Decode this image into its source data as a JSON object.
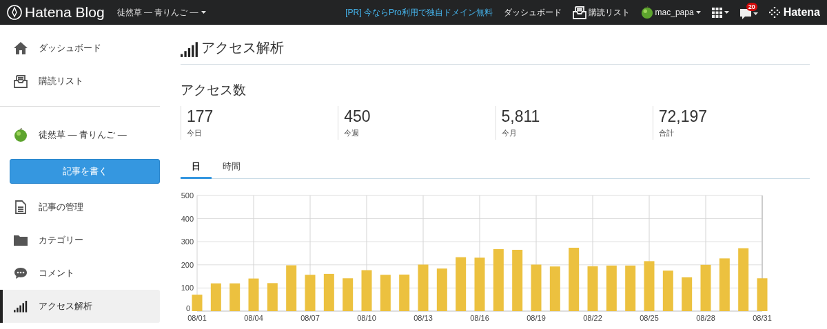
{
  "topbar": {
    "logo": "Hatena Blog",
    "blog_menu": "徒然草 — 青りんご —",
    "promo": "[PR] 今ならPro利用で独自ドメイン無料",
    "links": [
      {
        "kind": "text",
        "label": "ダッシュボード"
      },
      {
        "kind": "reader",
        "label": "購読リスト"
      }
    ],
    "user": "mac_papa",
    "notification_count": "20",
    "brand": "Hatena"
  },
  "sidebar": {
    "items": [
      {
        "kind": "home",
        "label": "ダッシュボード",
        "selected": false
      },
      {
        "kind": "reader",
        "label": "購読リスト",
        "selected": false
      },
      {
        "kind": "divider"
      },
      {
        "kind": "blog",
        "label": "徒然草 — 青りんご —",
        "selected": false
      },
      {
        "kind": "write",
        "label": "記事を書く"
      },
      {
        "kind": "doc",
        "label": "記事の管理",
        "selected": false
      },
      {
        "kind": "folder",
        "label": "カテゴリー",
        "selected": false
      },
      {
        "kind": "comment",
        "label": "コメント",
        "selected": false
      },
      {
        "kind": "signal",
        "label": "アクセス解析",
        "selected": true
      }
    ]
  },
  "main": {
    "title": "アクセス解析",
    "section_title": "アクセス数",
    "stats": [
      {
        "value": "177",
        "label": "今日"
      },
      {
        "value": "450",
        "label": "今週"
      },
      {
        "value": "5,811",
        "label": "今月"
      },
      {
        "value": "72,197",
        "label": "合計"
      }
    ],
    "tabs": [
      {
        "label": "日",
        "selected": true
      },
      {
        "label": "時間",
        "selected": false
      }
    ],
    "chart_data": {
      "type": "bar",
      "grid": true,
      "categories": [
        "08/01",
        null,
        null,
        "08/04",
        null,
        null,
        "08/07",
        null,
        null,
        "08/10",
        null,
        null,
        "08/13",
        null,
        null,
        "08/16",
        null,
        null,
        "08/19",
        null,
        null,
        "08/22",
        null,
        null,
        "08/25",
        null,
        null,
        "08/28",
        null,
        null,
        "08/31"
      ],
      "series": [
        {
          "color": "#ecc13f",
          "values": [
            71,
            120,
            120,
            141,
            121,
            198,
            157,
            161,
            142,
            177,
            157,
            158,
            201,
            184,
            233,
            231,
            268,
            265,
            201,
            193,
            274,
            194,
            197,
            197,
            216,
            175,
            146,
            200,
            228,
            272,
            142
          ]
        }
      ],
      "ylim": [
        0,
        500
      ],
      "yticks": [
        0,
        100,
        200,
        300,
        400,
        500
      ]
    }
  }
}
